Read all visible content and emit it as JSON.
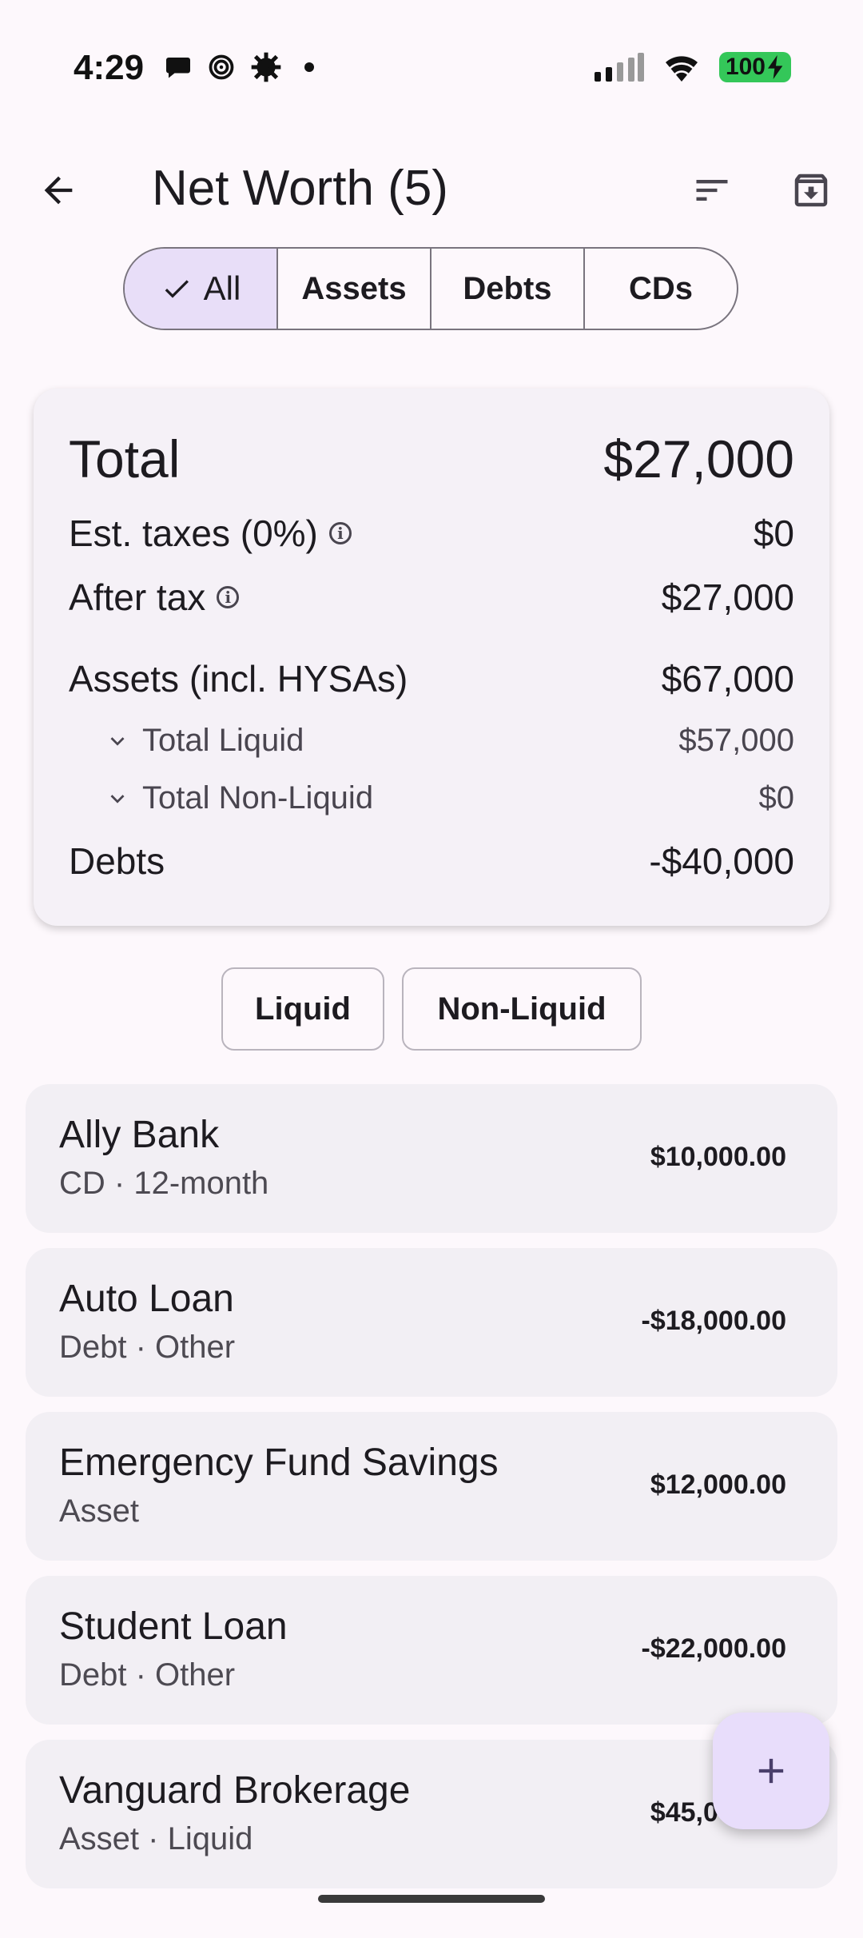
{
  "status_bar": {
    "time": "4:29",
    "battery": "100"
  },
  "app_bar": {
    "title": "Net Worth (5)"
  },
  "segments": [
    {
      "label": "All",
      "selected": true
    },
    {
      "label": "Assets",
      "selected": false
    },
    {
      "label": "Debts",
      "selected": false
    },
    {
      "label": "CDs",
      "selected": false
    }
  ],
  "summary": {
    "total_label": "Total",
    "total_value": "$27,000",
    "taxes_label": "Est. taxes (0%)",
    "taxes_value": "$0",
    "after_tax_label": "After tax",
    "after_tax_value": "$27,000",
    "assets_label": "Assets (incl. HYSAs)",
    "assets_value": "$67,000",
    "liquid_label": "Total Liquid",
    "liquid_value": "$57,000",
    "nonliquid_label": "Total Non-Liquid",
    "nonliquid_value": "$0",
    "debts_label": "Debts",
    "debts_value": "-$40,000"
  },
  "filters": {
    "liquid": "Liquid",
    "non_liquid": "Non-Liquid"
  },
  "accounts": [
    {
      "name": "Ally Bank",
      "subtitle": "CD · 12-month",
      "amount": "$10,000.00"
    },
    {
      "name": "Auto Loan",
      "subtitle": "Debt · Other",
      "amount": "-$18,000.00"
    },
    {
      "name": "Emergency Fund Savings",
      "subtitle": "Asset",
      "amount": "$12,000.00"
    },
    {
      "name": "Student Loan",
      "subtitle": "Debt · Other",
      "amount": "-$22,000.00"
    },
    {
      "name": "Vanguard Brokerage",
      "subtitle": "Asset · Liquid",
      "amount": "$45,000.00"
    }
  ],
  "colors": {
    "accent_container": "#e8def8",
    "fab": "#e8ddfb",
    "battery": "#34c759"
  }
}
